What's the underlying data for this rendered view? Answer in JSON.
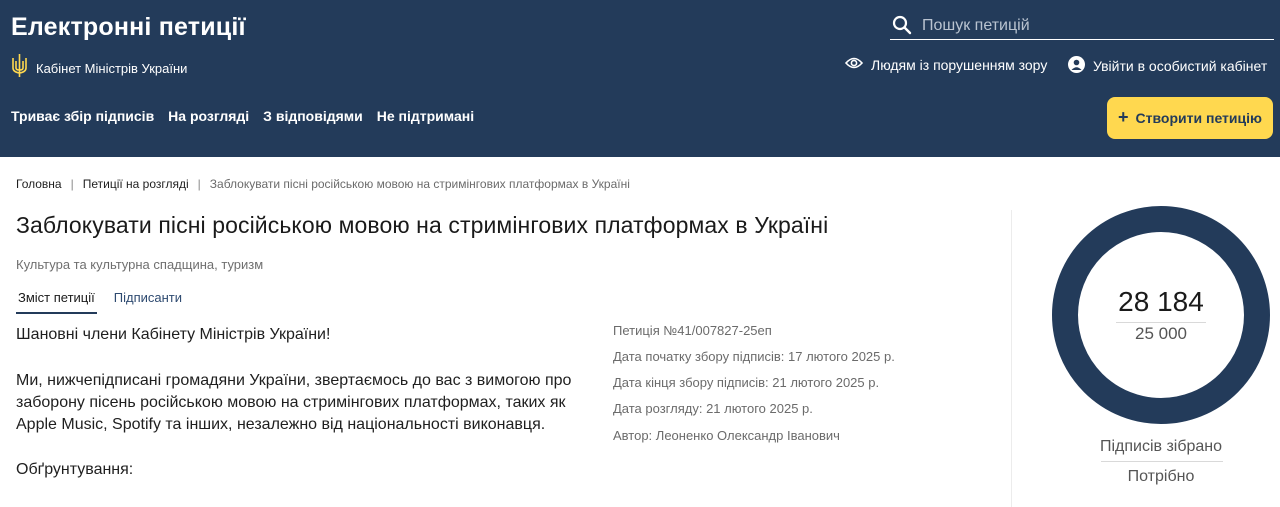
{
  "header": {
    "site_title": "Електронні петиції",
    "gov_label": "Кабінет Міністрів України",
    "search_placeholder": "Пошук петицій",
    "accessibility_label": "Людям із порушенням зору",
    "login_label": "Увійти в особистий кабінет",
    "create_label": "Створити петицію",
    "create_icon": "+",
    "nav": [
      "Триває збір підписів",
      "На розгляді",
      "З відповідями",
      "Не підтримані"
    ]
  },
  "colors": {
    "header_bg": "#233b5a",
    "accent_yellow": "#ffd84f",
    "ring": "#233b5a"
  },
  "breadcrumb": {
    "home": "Головна",
    "section": "Петиції на розгляді",
    "current": "Заблокувати пісні російською мовою на стримінгових платформах в Україні"
  },
  "petition": {
    "title": "Заблокувати пісні російською мовою на стримінгових платформах в Україні",
    "category": "Культура та культурна спадщина, туризм",
    "tabs": [
      "Зміст петиції",
      "Підписанти"
    ],
    "greeting": "Шановні члени Кабінету Міністрів України!",
    "paragraph": "Ми, нижчепідписані громадяни України, звертаємось до вас з вимогою про заборону пісень російською мовою на стримінгових платформах, таких як Apple Music, Spotify та інших, незалежно від національності виконавця.",
    "justification_label": "Обґрунтування:",
    "meta": {
      "number": "Петиція №41/007827-25еп",
      "start_date": "Дата початку збору підписів: 17 лютого 2025 р.",
      "end_date": "Дата кінця збору підписів: 21 лютого 2025 р.",
      "review_date": "Дата розгляду: 21 лютого 2025 р.",
      "author": "Автор: Леоненко Олександр Іванович"
    }
  },
  "signatures": {
    "collected": "28 184",
    "required": "25 000",
    "collected_label": "Підписів зібрано",
    "required_label": "Потрібно",
    "progress_percent": 100
  },
  "icons": {
    "search": "search-icon",
    "eye": "eye-icon",
    "user": "user-icon",
    "trident": "trident-icon"
  }
}
